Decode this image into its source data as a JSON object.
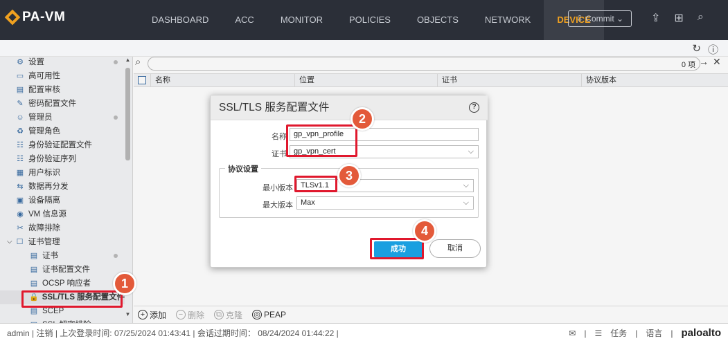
{
  "app": {
    "title": "PA-VM"
  },
  "nav": {
    "tabs": [
      "DASHBOARD",
      "ACC",
      "MONITOR",
      "POLICIES",
      "OBJECTS",
      "NETWORK",
      "DEVICE"
    ],
    "active": "DEVICE",
    "commit_label": "Commit"
  },
  "sidebar": {
    "items": [
      {
        "label": "设置",
        "icon": "settings-icon"
      },
      {
        "label": "高可用性",
        "icon": "ha-icon"
      },
      {
        "label": "配置审核",
        "icon": "config-audit-icon"
      },
      {
        "label": "密码配置文件",
        "icon": "password-profile-icon"
      },
      {
        "label": "管理员",
        "icon": "admin-icon"
      },
      {
        "label": "管理角色",
        "icon": "admin-role-icon"
      },
      {
        "label": "身份验证配置文件",
        "icon": "auth-profile-icon"
      },
      {
        "label": "身份验证序列",
        "icon": "auth-sequence-icon"
      },
      {
        "label": "用户标识",
        "icon": "user-id-icon"
      },
      {
        "label": "数据再分发",
        "icon": "data-redistribution-icon"
      },
      {
        "label": "设备隔离",
        "icon": "device-quarantine-icon"
      },
      {
        "label": "VM 信息源",
        "icon": "vm-info-icon"
      },
      {
        "label": "故障排除",
        "icon": "troubleshooting-icon"
      },
      {
        "label": "证书管理",
        "icon": "cert-mgmt-icon"
      },
      {
        "label": "证书",
        "icon": "certificate-icon"
      },
      {
        "label": "证书配置文件",
        "icon": "cert-profile-icon"
      },
      {
        "label": "OCSP 响应者",
        "icon": "ocsp-icon"
      },
      {
        "label": "SSL/TLS 服务配置文件",
        "icon": "lock-icon"
      },
      {
        "label": "SCEP",
        "icon": "scep-icon"
      },
      {
        "label": "SSL 解密排除",
        "icon": "ssl-exclusion-icon"
      }
    ]
  },
  "search": {
    "count": "0 项"
  },
  "table": {
    "columns": [
      "名称",
      "位置",
      "证书",
      "协议版本"
    ]
  },
  "footer": {
    "add": "添加",
    "delete": "删除",
    "clone": "克隆",
    "peap": "PEAP"
  },
  "dialog": {
    "title": "SSL/TLS 服务配置文件",
    "name_label": "名称",
    "name_value": "gp_vpn_profile",
    "cert_label": "证书",
    "cert_value": "gp_vpn_cert",
    "protocol_legend": "协议设置",
    "min_label": "最小版本",
    "min_value": "TLSv1.1",
    "max_label": "最大版本",
    "max_value": "Max",
    "ok_label": "成功",
    "cancel_label": "取消"
  },
  "markers": [
    "1",
    "2",
    "3",
    "4"
  ],
  "status": {
    "user": "admin",
    "logout": "注销",
    "last_login": "上次登录时间: 07/25/2024 01:43:41",
    "session_expire": "会话过期时间： 08/24/2024 01:44:22",
    "tasks": "任务",
    "language": "语言",
    "brand": "paloalto"
  },
  "colors": {
    "accent": "#f0a120",
    "primary_button": "#1a9fe0",
    "highlight": "#e0182d",
    "marker": "#e35a3a"
  }
}
